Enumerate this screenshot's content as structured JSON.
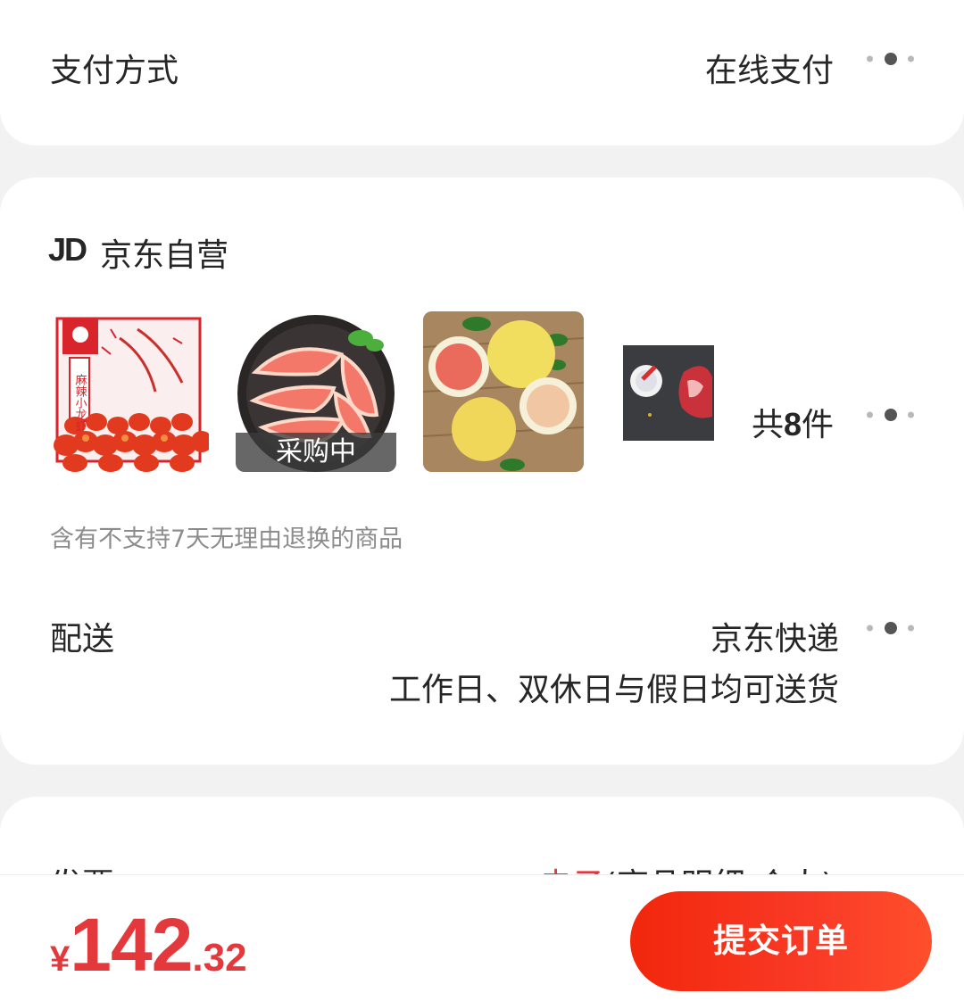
{
  "payment": {
    "label": "支付方式",
    "value": "在线支付"
  },
  "store": {
    "logo": "JD",
    "name": "京东自营"
  },
  "products": {
    "thumb1_text": "麻辣小龙虾",
    "thumb2_badge": "采购中",
    "count_prefix": "共",
    "count_number": "8",
    "count_suffix": "件"
  },
  "return_notice": "含有不支持7天无理由退换的商品",
  "shipping": {
    "label": "配送",
    "value": "京东快递",
    "note": "工作日、双休日与假日均可送货"
  },
  "invoice": {
    "label": "发票",
    "type": "电子",
    "detail": "(商品明细-个人)"
  },
  "total": {
    "currency": "¥",
    "integer": "142",
    "decimal": ".32"
  },
  "submit_label": "提交订单",
  "colors": {
    "accent": "#e4393c",
    "button": "#f2270c"
  }
}
